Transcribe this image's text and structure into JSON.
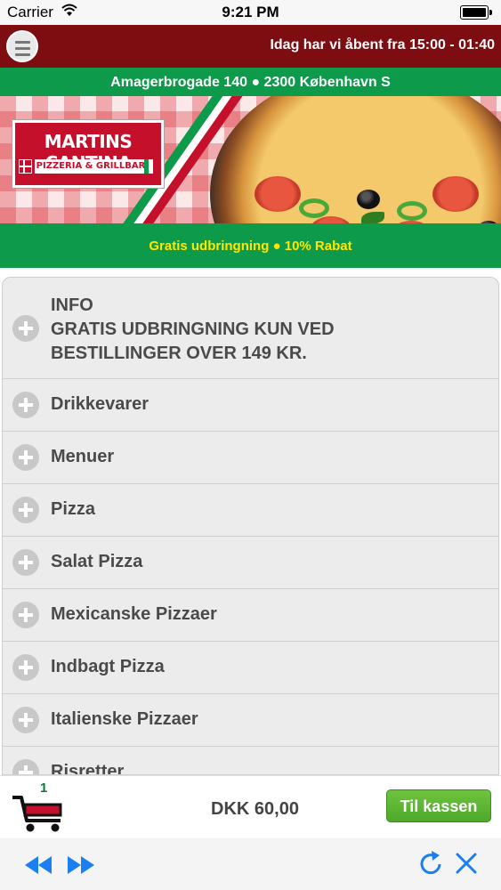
{
  "status_bar": {
    "carrier": "Carrier",
    "time": "9:21 PM"
  },
  "header": {
    "opening_hours": "Idag har vi åbent fra 15:00 - 01:40"
  },
  "address": "Amagerbrogade 140 ● 2300 København S",
  "banner": {
    "logo_title": "MARTINS CANTINA",
    "logo_subtitle": "PIZZERIA & GRILLBAR"
  },
  "promo": "Gratis udbringning ● 10% Rabat",
  "categories": {
    "info": {
      "line1": "INFO",
      "line2": "GRATIS UDBRINGNING KUN VED",
      "line3": "BESTILLINGER OVER 149 KR."
    },
    "items": [
      "Drikkevarer",
      "Menuer",
      "Pizza",
      "Salat Pizza",
      "Mexicanske Pizzaer",
      "Indbagt Pizza",
      "Italienske Pizzaer",
      "Risretter"
    ]
  },
  "cart": {
    "count": "1",
    "total": "DKK 60,00",
    "checkout_label": "Til kassen"
  },
  "colors": {
    "header_red": "#7d0d10",
    "green": "#0d9a4a",
    "promo_yellow": "#ffe600",
    "checkout_green": "#5cb531",
    "toolbar_blue": "#1a7ff0"
  },
  "toolbar_icons": [
    "back-icon",
    "forward-icon",
    "refresh-icon",
    "close-icon"
  ]
}
